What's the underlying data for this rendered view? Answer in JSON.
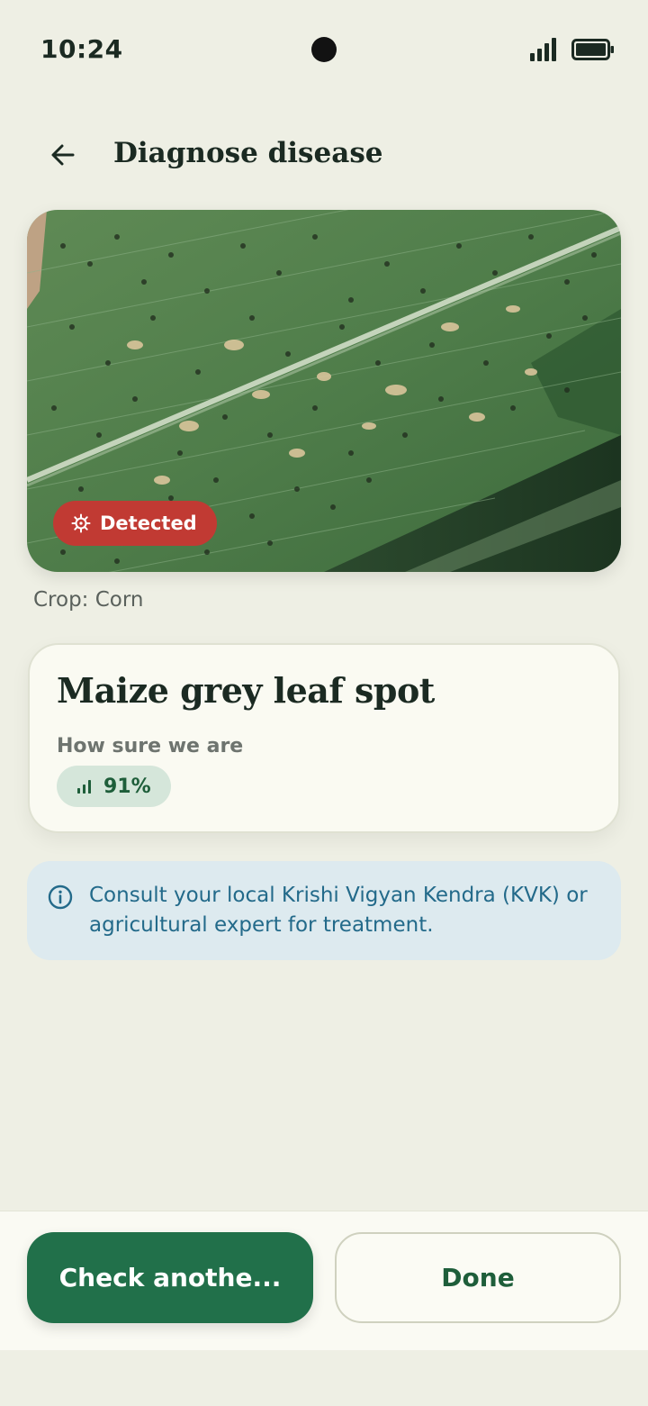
{
  "status_bar": {
    "time": "10:24",
    "signal_icon": "cellular-signal-icon",
    "battery_icon": "battery-full-icon"
  },
  "header": {
    "back_icon": "arrow-left-icon",
    "title": "Diagnose disease"
  },
  "photo": {
    "subject": "leaf-photo",
    "badge_icon": "virus-icon",
    "badge_label": "Detected",
    "badge_color": "#c13a33"
  },
  "crop_label": "Crop: Corn",
  "result": {
    "disease_name": "Maize grey leaf spot",
    "confidence_label": "How sure we are",
    "confidence_icon": "signal-bars-icon",
    "confidence_value": "91%",
    "confidence_percent": 91
  },
  "info": {
    "icon": "info-circle-icon",
    "text": "Consult your local Krishi Vigyan Kendra (KVK) or agricultural expert for treatment."
  },
  "actions": {
    "primary_label": "Check anothe...",
    "secondary_label": "Done"
  },
  "colors": {
    "background": "#eeefe4",
    "primary": "#21704a",
    "detected": "#c13a33",
    "info_bg": "#ddeaef",
    "info_text": "#236a8a"
  }
}
